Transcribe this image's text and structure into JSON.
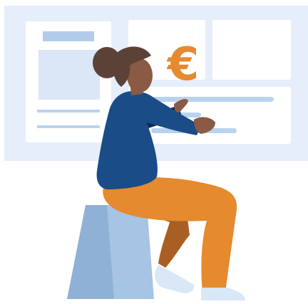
{
  "illustration": {
    "currency_symbol": "€",
    "colors": {
      "backdrop": "#e6eefb",
      "panel": "#ffffff",
      "placeholder_block": "#dbe6f6",
      "title_bar": "#b3cbea",
      "text_line": "#b9d3ee",
      "currency": "#e58a2e",
      "sweater": "#1a4c87",
      "pants": "#e58a2e",
      "pants_shadow": "#a95f24",
      "skin": "#8a5a44",
      "hair": "#5c4236",
      "stool_front": "#a6c4e4",
      "stool_side": "#8fb1d6",
      "shoe": "#d9e7f7"
    }
  }
}
